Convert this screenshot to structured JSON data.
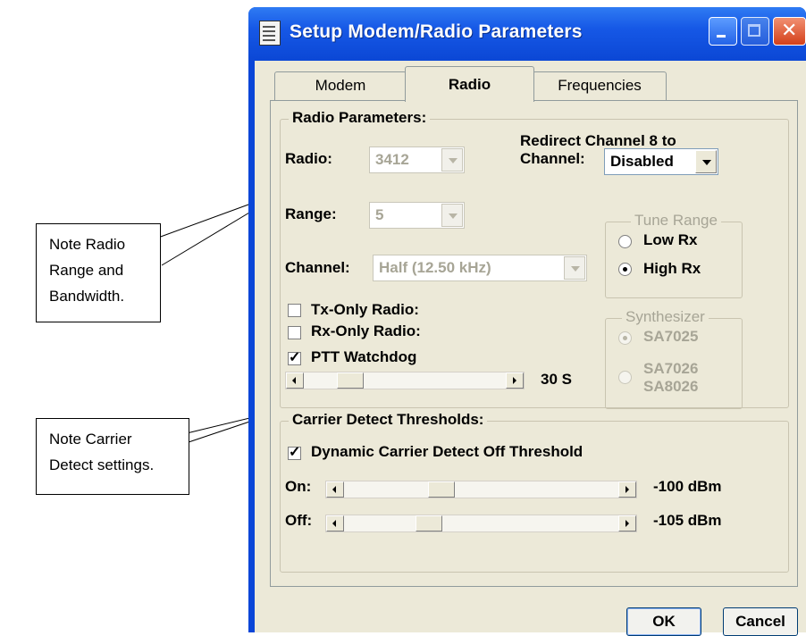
{
  "window": {
    "title": "Setup Modem/Radio Parameters",
    "buttons": [
      "minimize",
      "maximize",
      "close"
    ]
  },
  "tabs": [
    {
      "label": "Modem",
      "selected": false
    },
    {
      "label": "Radio",
      "selected": true
    },
    {
      "label": "Frequencies",
      "selected": false
    }
  ],
  "radio_params": {
    "title": "Radio Parameters:",
    "radio_label": "Radio:",
    "radio_value": "3412",
    "range_label": "Range:",
    "range_value": "5",
    "channel_label": "Channel:",
    "channel_value": "Half (12.50 kHz)",
    "redirect_label_line1": "Redirect Channel 8 to",
    "redirect_label_line2": "Channel:",
    "redirect_value": "Disabled",
    "tune_range": {
      "title": "Tune Range",
      "low": "Low Rx",
      "high": "High Rx",
      "selected": "High Rx"
    },
    "synthesizer": {
      "title": "Synthesizer",
      "opt1": "SA7025",
      "opt2_line1": "SA7026",
      "opt2_line2": "SA8026",
      "selected": "SA7025"
    },
    "tx_only": {
      "label": "Tx-Only Radio:",
      "checked": false
    },
    "rx_only": {
      "label": "Rx-Only Radio:",
      "checked": false
    },
    "ptt": {
      "label": "PTT Watchdog",
      "checked": true
    },
    "ptt_slider": {
      "value_text": "30 S",
      "position": 0.19
    }
  },
  "carrier": {
    "title": "Carrier Detect Thresholds:",
    "dynamic": {
      "label": "Dynamic Carrier Detect Off Threshold",
      "checked": true
    },
    "on_label": "On:",
    "on_value": "-100 dBm",
    "on_position": 0.34,
    "off_label": "Off:",
    "off_value": "-105 dBm",
    "off_position": 0.29
  },
  "buttons": {
    "ok": "OK",
    "cancel": "Cancel"
  },
  "callouts": [
    {
      "line1": "Note Radio",
      "line2": "Range and",
      "line3": "Bandwidth."
    },
    {
      "line1": "Note Carrier",
      "line2": "Detect settings."
    }
  ],
  "colors": {
    "title_bar": "#0b47d5",
    "dialog_bg": "#ece9d8",
    "close_button": "#d4401a"
  }
}
